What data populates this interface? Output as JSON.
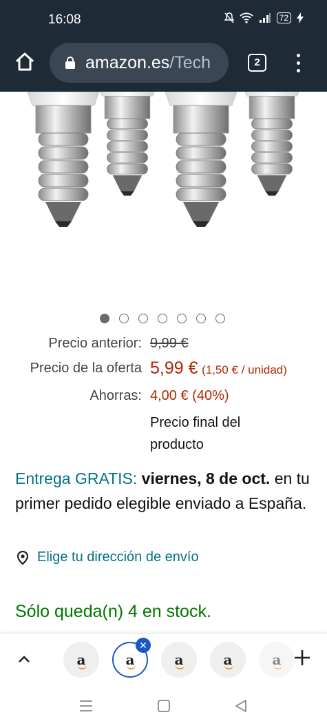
{
  "status": {
    "time": "16:08",
    "battery": "72"
  },
  "browser": {
    "url_host": "amazon.es",
    "url_path": "/Tech",
    "tab_count": "2"
  },
  "carousel": {
    "count": 7,
    "active": 0
  },
  "price": {
    "previous_label": "Precio anterior:",
    "previous_value": "9,99 €",
    "offer_label": "Precio de la oferta",
    "offer_value": "5,99 €",
    "unit_price": "(1,50 € / unidad)",
    "savings_label": "Ahorras:",
    "savings_value": "4,00 € (40%)",
    "final_note": "Precio final del producto"
  },
  "delivery": {
    "free_label": "Entrega GRATIS:",
    "date": "viernes, 8 de oct.",
    "details": "en tu primer pedido elegible enviado a España."
  },
  "location": {
    "label": "Elige tu dirección de envío"
  },
  "stock": {
    "text": "Sólo queda(n) 4 en stock."
  },
  "tabstrip": {
    "tabs": [
      {
        "logo": "a"
      },
      {
        "logo": "a",
        "selected": true
      },
      {
        "logo": "a"
      },
      {
        "logo": "a"
      },
      {
        "logo": "a"
      }
    ]
  },
  "colors": {
    "toolbar": "#1f2a37",
    "price_red": "#b12704",
    "link_teal": "#007185",
    "stock_green": "#007600",
    "selected_tab": "#1a56c4"
  }
}
